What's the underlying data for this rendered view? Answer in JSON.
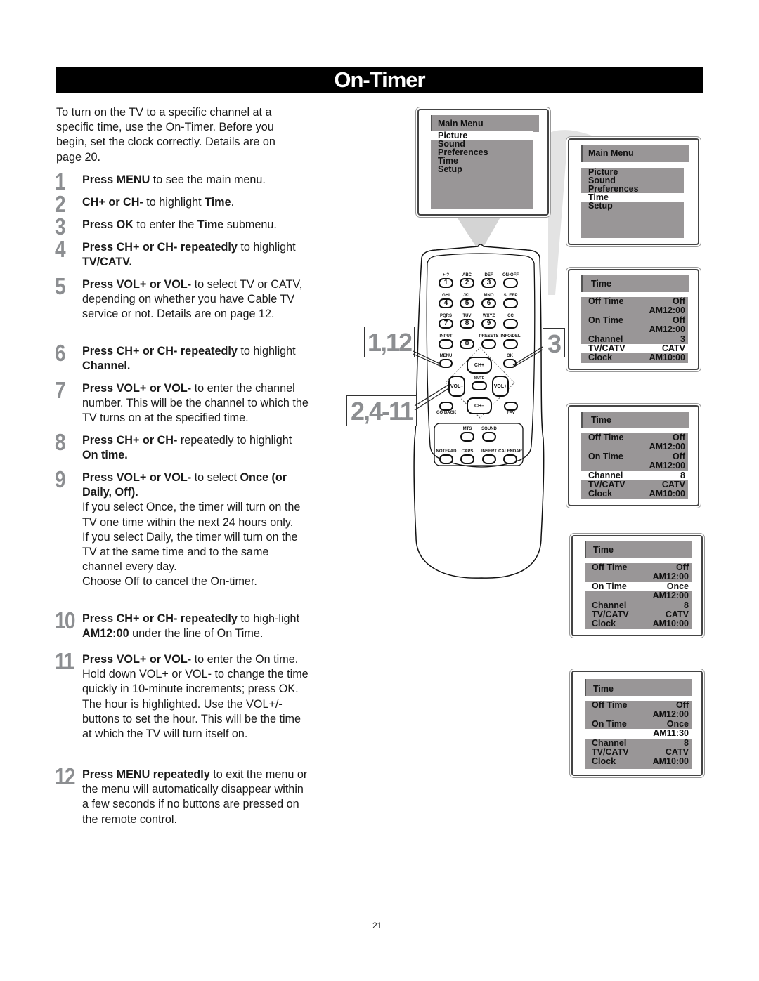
{
  "page": {
    "title": "On-Timer",
    "page_number": "21"
  },
  "intro": "To turn on the TV to a specific channel at a specific time, use the On-Timer. Before you begin, set the clock correctly. Details are on page 20.",
  "steps": [
    {
      "num": "1",
      "parts": [
        [
          "b",
          "Press MENU"
        ],
        [
          "t",
          " to see the main menu."
        ]
      ]
    },
    {
      "num": "2",
      "parts": [
        [
          "b",
          "CH+ or CH-"
        ],
        [
          "t",
          " to highlight "
        ],
        [
          "b",
          "Time"
        ],
        [
          "t",
          "."
        ]
      ]
    },
    {
      "num": "3",
      "parts": [
        [
          "b",
          "Press OK"
        ],
        [
          "t",
          " to enter the "
        ],
        [
          "b",
          "Time"
        ],
        [
          "t",
          " submenu."
        ]
      ]
    },
    {
      "num": "4",
      "parts": [
        [
          "b",
          "Press CH+ or CH- repeatedly"
        ],
        [
          "t",
          " to highlight "
        ],
        [
          "b",
          "TV/CATV."
        ]
      ]
    },
    {
      "num": "5",
      "parts": [
        [
          "b",
          "Press VOL+ or VOL-"
        ],
        [
          "t",
          " to select TV or CATV, depending on whether you have Cable TV service or not. Details are on page 12."
        ]
      ]
    },
    {
      "num": "6",
      "parts": [
        [
          "b",
          "Press CH+ or CH- repeatedly"
        ],
        [
          "t",
          " to highlight "
        ],
        [
          "b",
          "Channel."
        ]
      ]
    },
    {
      "num": "7",
      "parts": [
        [
          "b",
          "Press VOL+ or VOL-"
        ],
        [
          "t",
          " to enter the channel number. This will be the channel to which the TV turns on at the specified time."
        ]
      ]
    },
    {
      "num": "8",
      "parts": [
        [
          "b",
          "Press CH+ or CH-"
        ],
        [
          "t",
          " repeatedly to highlight "
        ],
        [
          "b",
          "On time."
        ]
      ]
    },
    {
      "num": "9",
      "parts": [
        [
          "b",
          "Press VOL+ or VOL-"
        ],
        [
          "t",
          " to select "
        ],
        [
          "b",
          "Once (or Daily, Off)."
        ],
        [
          "br",
          ""
        ],
        [
          "t",
          "If you select Once, the timer will turn on the TV one time within the next 24 hours only."
        ],
        [
          "br",
          ""
        ],
        [
          "t",
          "If you select Daily, the timer will turn on the TV at the same time and to the same channel every day."
        ],
        [
          "br",
          ""
        ],
        [
          "t",
          "Choose Off to cancel the On-timer."
        ]
      ]
    },
    {
      "num": "10",
      "parts": [
        [
          "b",
          "Press CH+ or CH- repeatedly"
        ],
        [
          "t",
          " to high-light "
        ],
        [
          "b",
          "AM12:00"
        ],
        [
          "t",
          " under the line of On Time."
        ]
      ]
    },
    {
      "num": "11",
      "parts": [
        [
          "b",
          "Press VOL+ or VOL-"
        ],
        [
          "t",
          " to enter the On time. Hold down VOL+ or VOL- to change the time quickly in 10-minute increments; press OK. The hour is highlighted. Use the VOL+/- buttons to set the hour. This will be the time at which the TV will turn itself on."
        ]
      ]
    },
    {
      "num": "12",
      "parts": [
        [
          "b",
          "Press MENU repeatedly"
        ],
        [
          "t",
          " to exit the menu or the menu will automatically disappear within a few seconds if no buttons are pressed on the remote control."
        ]
      ]
    }
  ],
  "callouts": {
    "menu": "1,12",
    "ok": "3",
    "nav": "2,4-11"
  },
  "remote": {
    "rows": [
      [
        {
          "top": "+-?",
          "label": "1"
        },
        {
          "top": "ABC",
          "label": "2"
        },
        {
          "top": "DEF",
          "label": "3"
        },
        {
          "top": "ON-OFF",
          "label": ""
        }
      ],
      [
        {
          "top": "GHI",
          "label": "4"
        },
        {
          "top": "JKL",
          "label": "5"
        },
        {
          "top": "MNO",
          "label": "6"
        },
        {
          "top": "SLEEP",
          "label": ""
        }
      ],
      [
        {
          "top": "PQRS",
          "label": "7"
        },
        {
          "top": "TUV",
          "label": "8"
        },
        {
          "top": "WXYZ",
          "label": "9"
        },
        {
          "top": "CC",
          "label": ""
        }
      ],
      [
        {
          "top": "INPUT",
          "label": ""
        },
        {
          "top": "",
          "label": "0"
        },
        {
          "top": "PRESETS",
          "label": ""
        },
        {
          "top": "INFO/DEL",
          "label": ""
        }
      ]
    ],
    "menu": "MENU",
    "ok": "OK",
    "ch_up": "CH+",
    "ch_down": "CH–",
    "vol_down": "VOL–",
    "vol_up": "VOL+",
    "mute": "MUTE",
    "go_back": "GO BACK",
    "fav": "FAV",
    "mts": "MTS",
    "sound": "SOUND",
    "notepad": "NOTEPAD",
    "caps": "CAPS",
    "insert": "INSERT",
    "calendar": "CALENDAR"
  },
  "screens": {
    "main_menu_1": {
      "title": "Main Menu",
      "items": [
        "Picture",
        "Sound",
        "Preferences",
        "Time",
        "Setup"
      ],
      "highlighted": "Picture"
    },
    "main_menu_2": {
      "title": "Main Menu",
      "items": [
        "Picture",
        "Sound",
        "Preferences",
        "Time",
        "Setup"
      ],
      "highlighted": "Time"
    },
    "time_1": {
      "title": "Time",
      "rows": [
        {
          "label": "Off Time",
          "value": "Off"
        },
        {
          "label": "",
          "value": "AM12:00"
        },
        {
          "label": "On Time",
          "value": "Off"
        },
        {
          "label": "",
          "value": "AM12:00"
        },
        {
          "label": "Channel",
          "value": "3"
        },
        {
          "label": "TV/CATV",
          "value": "CATV"
        },
        {
          "label": "Clock",
          "value": "AM10:00"
        }
      ],
      "highlighted_row": 5
    },
    "time_2": {
      "title": "Time",
      "rows": [
        {
          "label": "Off Time",
          "value": "Off"
        },
        {
          "label": "",
          "value": "AM12:00"
        },
        {
          "label": "On Time",
          "value": "Off"
        },
        {
          "label": "",
          "value": "AM12:00"
        },
        {
          "label": "Channel",
          "value": "8"
        },
        {
          "label": "TV/CATV",
          "value": "CATV"
        },
        {
          "label": "Clock",
          "value": "AM10:00"
        }
      ],
      "highlighted_row": 4
    },
    "time_3": {
      "title": "Time",
      "rows": [
        {
          "label": "Off Time",
          "value": "Off"
        },
        {
          "label": "",
          "value": "AM12:00"
        },
        {
          "label": "On Time",
          "value": "Once"
        },
        {
          "label": "",
          "value": "AM12:00"
        },
        {
          "label": "Channel",
          "value": "8"
        },
        {
          "label": "TV/CATV",
          "value": "CATV"
        },
        {
          "label": "Clock",
          "value": "AM10:00"
        }
      ],
      "highlighted_row": 2
    },
    "time_4": {
      "title": "Time",
      "rows": [
        {
          "label": "Off Time",
          "value": "Off"
        },
        {
          "label": "",
          "value": "AM12:00"
        },
        {
          "label": "On Time",
          "value": "Once"
        },
        {
          "label": "",
          "value": "AM11:30"
        },
        {
          "label": "Channel",
          "value": "8"
        },
        {
          "label": "TV/CATV",
          "value": "CATV"
        },
        {
          "label": "Clock",
          "value": "AM10:00"
        }
      ],
      "highlighted_row": 3
    }
  }
}
